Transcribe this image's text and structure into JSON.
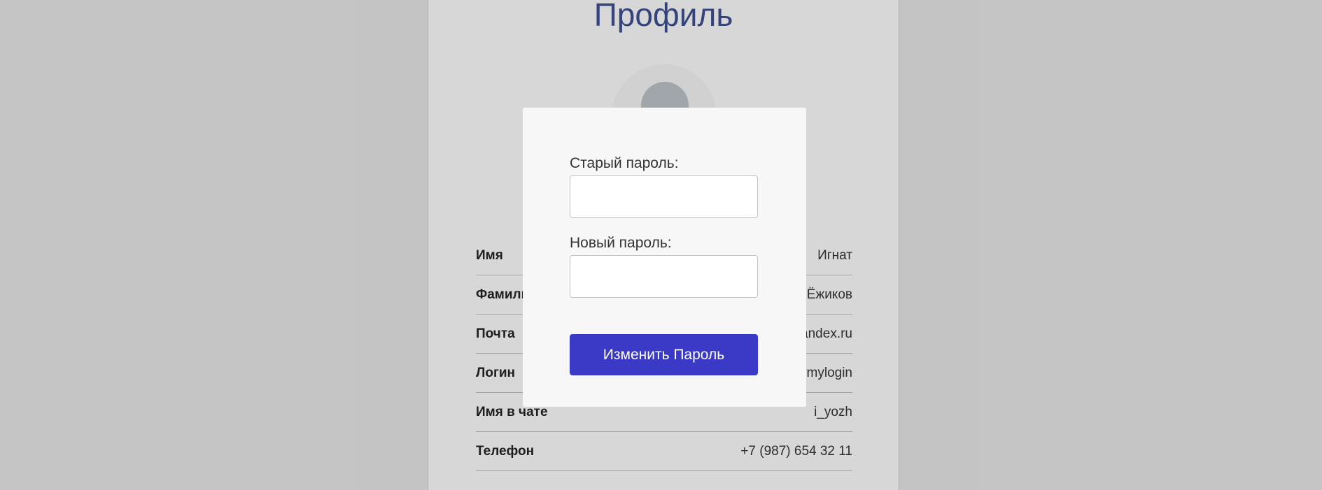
{
  "page": {
    "title": "Профиль"
  },
  "profile": {
    "rows": [
      {
        "label": "Имя",
        "value": "Игнат"
      },
      {
        "label": "Фамилия",
        "value": "Ёжиков"
      },
      {
        "label": "Почта",
        "value": "pochta@yandex.ru"
      },
      {
        "label": "Логин",
        "value": "ivanivanovmylogin"
      },
      {
        "label": "Имя в чате",
        "value": "i_yozh"
      },
      {
        "label": "Телефон",
        "value": "+7 (987) 654 32 11"
      }
    ]
  },
  "modal": {
    "old_password_label": "Старый пароль:",
    "old_password_value": "",
    "new_password_label": "Новый пароль:",
    "new_password_value": "",
    "submit_label": "Изменить Пароль"
  },
  "colors": {
    "accent": "#3a3ac6",
    "title": "#3b4b8c",
    "background": "#dbdbdb"
  },
  "icons": {
    "avatar": "user-avatar-icon"
  }
}
